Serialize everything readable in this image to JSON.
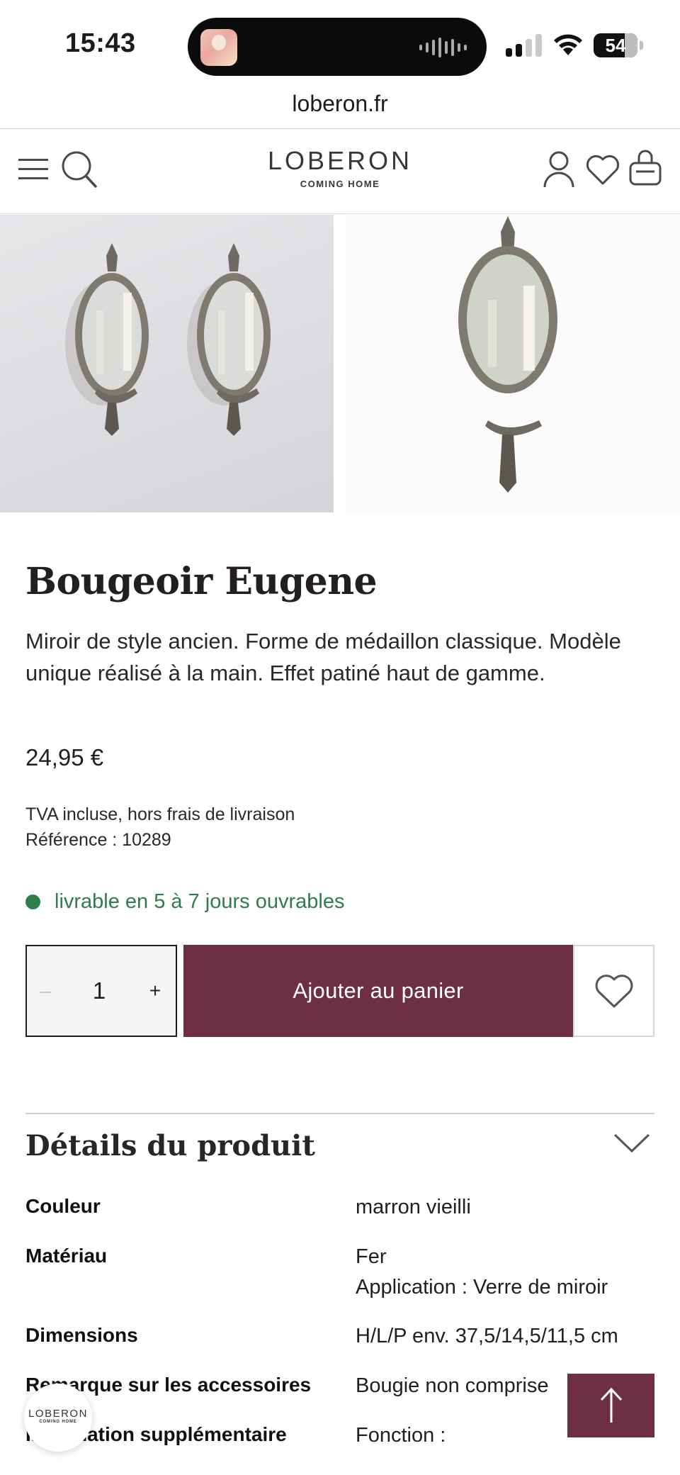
{
  "status_bar": {
    "time": "15:43",
    "battery": "54"
  },
  "browser": {
    "url": "loberon.fr"
  },
  "header": {
    "logo_name": "LOBERON",
    "logo_tagline": "COMING HOME",
    "icons": [
      "menu-icon",
      "search-icon",
      "account-icon",
      "heart-icon",
      "bag-icon"
    ]
  },
  "product": {
    "title": "Bougeoir Eugene",
    "description": "Miroir de style ancien. Forme de médaillon classique. Modèle unique réalisé à la main. Effet patiné haut de gamme.",
    "price": "24,95 €",
    "tax_note": "TVA incluse, hors frais de livraison",
    "reference": "Référence : 10289",
    "availability": "livrable en 5 à 7 jours ouvrables",
    "availability_color": "#2f7d4f"
  },
  "cart": {
    "minus": "–",
    "quantity": "1",
    "plus": "+",
    "add_label": "Ajouter au panier",
    "accent": "#6e2f43"
  },
  "details": {
    "title": "Détails du produit",
    "specs": [
      {
        "label": "Couleur",
        "value": "marron vieilli"
      },
      {
        "label": "Matériau",
        "value": "Fer",
        "value2": "Application : Verre de miroir"
      },
      {
        "label": "Dimensions",
        "value": "H/L/P env. 37,5/14,5/11,5 cm"
      },
      {
        "label": "Remarque sur les accessoires",
        "value": "Bougie non comprise"
      },
      {
        "label": "Information supplémentaire",
        "value": "Fonction :"
      }
    ]
  },
  "floating": {
    "chat_logo": "LOBERON",
    "chat_tagline": "COMING HOME"
  }
}
